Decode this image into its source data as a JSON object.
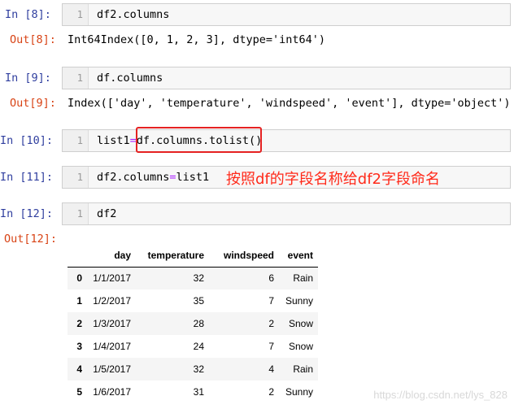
{
  "cells": [
    {
      "in_prompt": "In  [8]:",
      "line_no": "1",
      "code": "df2.columns",
      "out_prompt": "Out[8]:",
      "output": "Int64Index([0, 1, 2, 3], dtype='int64')"
    },
    {
      "in_prompt": "In  [9]:",
      "line_no": "1",
      "code": "df.columns",
      "out_prompt": "Out[9]:",
      "output": "Index(['day', 'temperature', 'windspeed', 'event'], dtype='object')"
    },
    {
      "in_prompt": "In  [10]:",
      "line_no": "1",
      "code_prefix": "list1",
      "code_op": "=",
      "code_rest": "df.columns.tolist()"
    },
    {
      "in_prompt": "In  [11]:",
      "line_no": "1",
      "code_prefix": "df2.columns",
      "code_op": "=",
      "code_rest": "list1"
    },
    {
      "in_prompt": "In  [12]:",
      "line_no": "1",
      "code": "df2",
      "out_prompt": "Out[12]:"
    }
  ],
  "annotation": "按照df的字段名称给df2字段命名",
  "highlight_color": "#e52222",
  "table": {
    "columns": [
      "",
      "day",
      "temperature",
      "windspeed",
      "event"
    ],
    "rows": [
      {
        "index": "0",
        "day": "1/1/2017",
        "temperature": "32",
        "windspeed": "6",
        "event": "Rain"
      },
      {
        "index": "1",
        "day": "1/2/2017",
        "temperature": "35",
        "windspeed": "7",
        "event": "Sunny"
      },
      {
        "index": "2",
        "day": "1/3/2017",
        "temperature": "28",
        "windspeed": "2",
        "event": "Snow"
      },
      {
        "index": "3",
        "day": "1/4/2017",
        "temperature": "24",
        "windspeed": "7",
        "event": "Snow"
      },
      {
        "index": "4",
        "day": "1/5/2017",
        "temperature": "32",
        "windspeed": "4",
        "event": "Rain"
      },
      {
        "index": "5",
        "day": "1/6/2017",
        "temperature": "31",
        "windspeed": "2",
        "event": "Sunny"
      }
    ]
  },
  "watermark": "https://blog.csdn.net/lys_828"
}
